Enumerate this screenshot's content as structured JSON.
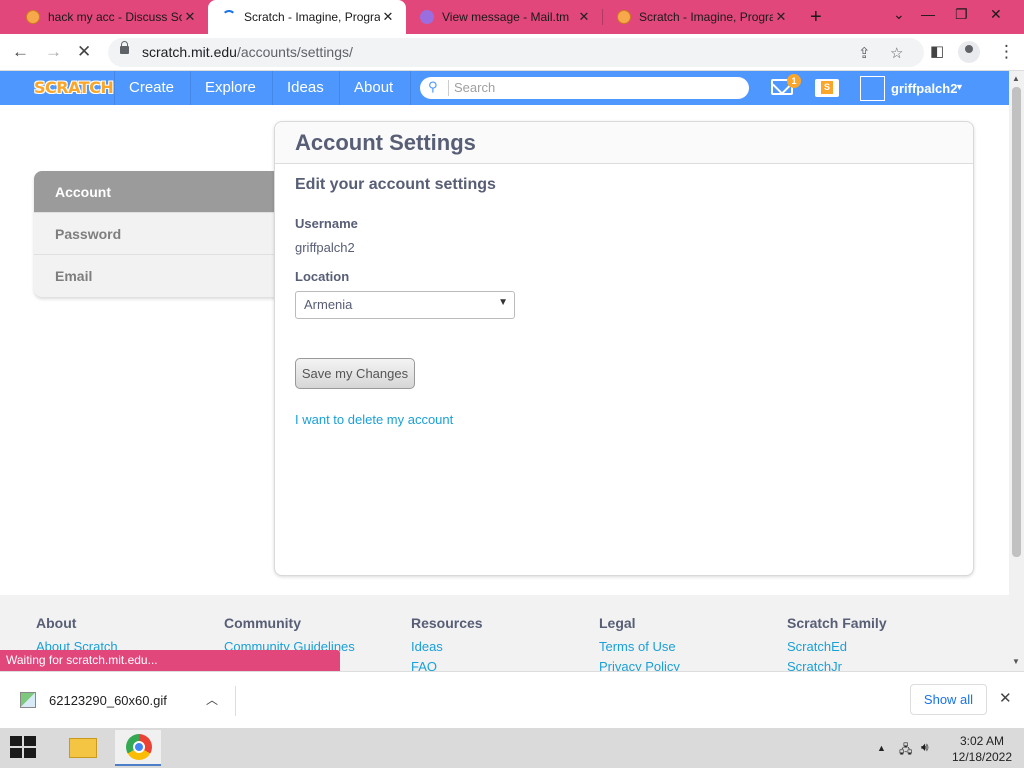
{
  "browser": {
    "tabs": [
      {
        "title": "hack my acc - Discuss Sc",
        "close": "✕",
        "icon": "scratch-cat-icon"
      },
      {
        "title": "Scratch - Imagine, Progra",
        "close": "✕",
        "icon": "loading-icon"
      },
      {
        "title": "View message - Mail.tm",
        "close": "✕",
        "icon": "mail-icon"
      },
      {
        "title": "Scratch - Imagine, Progra",
        "close": "✕",
        "icon": "scratch-cat-icon"
      }
    ],
    "new_tab": "+",
    "url_host": "scratch.mit.edu",
    "url_path": "/accounts/settings/"
  },
  "nav": {
    "logo": "SCRATCH",
    "links": [
      "Create",
      "Explore",
      "Ideas",
      "About"
    ],
    "search_placeholder": "Search",
    "message_count": "1",
    "username": "griffpalch2"
  },
  "sidebar": {
    "items": [
      {
        "label": "Account",
        "active": true
      },
      {
        "label": "Password",
        "active": false
      },
      {
        "label": "Email",
        "active": false
      }
    ]
  },
  "main": {
    "title": "Account Settings",
    "subtitle": "Edit your account settings",
    "username_label": "Username",
    "username_value": "griffpalch2",
    "location_label": "Location",
    "location_value": "Armenia",
    "save_label": "Save my Changes",
    "delete_label": "I want to delete my account"
  },
  "footer": {
    "columns": [
      {
        "heading": "About",
        "links": [
          "About Scratch"
        ]
      },
      {
        "heading": "Community",
        "links": [
          "Community Guidelines"
        ]
      },
      {
        "heading": "Resources",
        "links": [
          "Ideas",
          "FAQ"
        ]
      },
      {
        "heading": "Legal",
        "links": [
          "Terms of Use",
          "Privacy Policy"
        ]
      },
      {
        "heading": "Scratch Family",
        "links": [
          "ScratchEd",
          "ScratchJr"
        ]
      }
    ]
  },
  "status_text": "Waiting for scratch.mit.edu...",
  "downloads": {
    "file_name": "62123290_60x60.gif",
    "show_all": "Show all"
  },
  "taskbar": {
    "time": "3:02 AM",
    "date": "12/18/2022"
  },
  "colors": {
    "tab_strip": "#e1477a",
    "scratch_blue": "#4d97ff",
    "link": "#1aa0d8"
  }
}
